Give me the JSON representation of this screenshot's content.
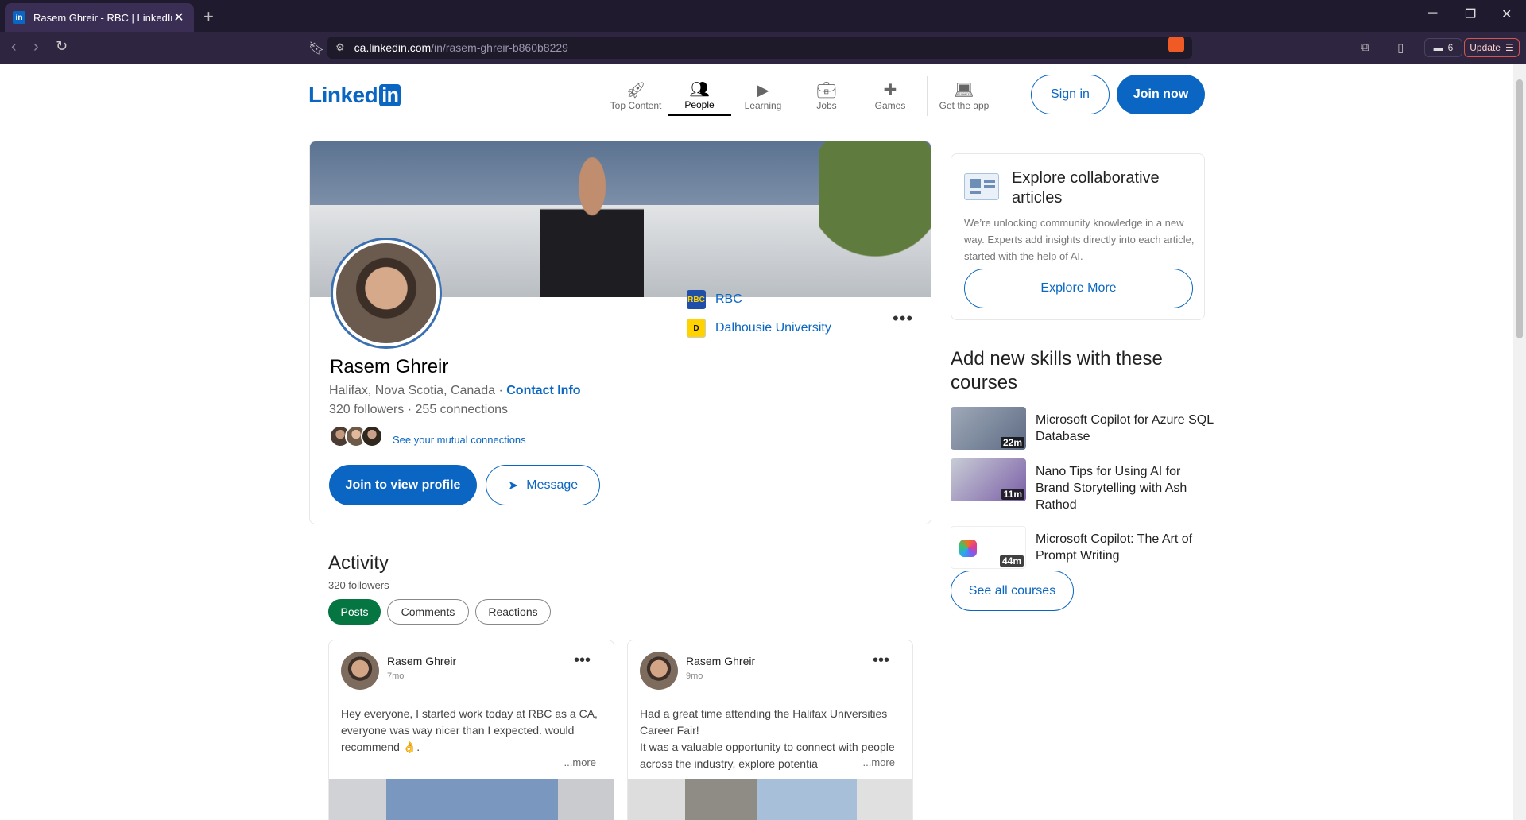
{
  "browser": {
    "tab_title": "Rasem Ghreir - RBC | LinkedIn",
    "url_host": "ca.linkedin.com",
    "url_path": "/in/rasem-ghreir-b860b8229",
    "wallet_count": "6",
    "update_label": "Update"
  },
  "header": {
    "logo_text": "Linked",
    "logo_in": "in",
    "nav": [
      {
        "label": "Top Content",
        "icon": "rocket-icon"
      },
      {
        "label": "People",
        "icon": "people-icon"
      },
      {
        "label": "Learning",
        "icon": "learning-icon"
      },
      {
        "label": "Jobs",
        "icon": "briefcase-icon"
      },
      {
        "label": "Games",
        "icon": "puzzle-icon"
      },
      {
        "label": "Get the app",
        "icon": "laptop-icon"
      }
    ],
    "sign_in": "Sign in",
    "join_now": "Join now"
  },
  "profile": {
    "name": "Rasem Ghreir",
    "location": "Halifax, Nova Scotia, Canada",
    "contact_info": "Contact Info",
    "followers": "320 followers",
    "connections": "255 connections",
    "mutual_link": "See your mutual connections",
    "join_button": "Join to view profile",
    "message_button": "Message",
    "orgs": [
      {
        "name": "RBC",
        "logo": "RBC"
      },
      {
        "name": "Dalhousie University",
        "logo": "D"
      }
    ]
  },
  "activity": {
    "title": "Activity",
    "followers": "320 followers",
    "tabs": [
      "Posts",
      "Comments",
      "Reactions"
    ],
    "posts": [
      {
        "author": "Rasem Ghreir",
        "time": "7mo",
        "text": "Hey everyone, I started work today at RBC as a CA, everyone was way nicer than I expected. would recommend 👌.",
        "more": "...more"
      },
      {
        "author": "Rasem Ghreir",
        "time": "9mo",
        "text": "Had a great time attending the Halifax Universities Career Fair!\n It was a valuable opportunity to connect with people across the industry, explore potentia",
        "more": "...more"
      }
    ]
  },
  "sidebar": {
    "collab": {
      "title": "Explore collaborative articles",
      "description": "We’re unlocking community knowledge in a new way. Experts add insights directly into each article, started with the help of AI.",
      "button": "Explore More"
    },
    "skills_title": "Add new skills with these courses",
    "courses": [
      {
        "title": "Microsoft Copilot for Azure SQL Database",
        "duration": "22m"
      },
      {
        "title": "Nano Tips for Using AI for Brand Storytelling with Ash Rathod",
        "duration": "11m"
      },
      {
        "title": "Microsoft Copilot: The Art of Prompt Writing",
        "duration": "44m"
      }
    ],
    "see_all": "See all courses"
  },
  "colors": {
    "brand_blue": "#0a66c2",
    "posts_green": "#057642"
  }
}
